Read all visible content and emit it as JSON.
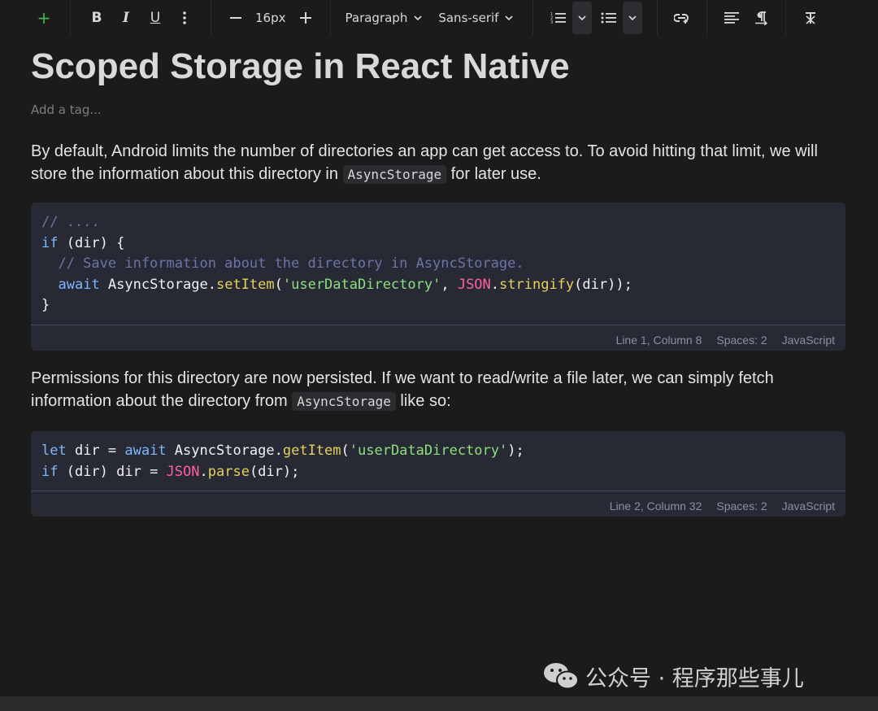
{
  "toolbar": {
    "font_size": "16px",
    "block_type": "Paragraph",
    "font_family": "Sans-serif"
  },
  "document": {
    "title": "Scoped Storage in React Native",
    "tag_placeholder": "Add a tag...",
    "para1": {
      "before": "By default, Android limits the number of directories an app can get access to. To avoid hitting that limit, we will store the information about this directory in ",
      "code": "AsyncStorage",
      "after": " for later use."
    },
    "code1": {
      "line1": "// ....",
      "line2_kw": "if",
      "line2_rest": " (dir) {",
      "line3": "  // Save information about the directory in AsyncStorage.",
      "line4_kw": "await",
      "line4_obj": " AsyncStorage.",
      "line4_fn": "setItem",
      "line4_p1": "(",
      "line4_str": "'userDataDirectory'",
      "line4_p2": ", ",
      "line4_json": "JSON",
      "line4_dot": ".",
      "line4_fn2": "stringify",
      "line4_end": "(dir));",
      "line5": "}",
      "status": {
        "position": "Line 1, Column 8",
        "spaces": "Spaces: 2",
        "language": "JavaScript"
      }
    },
    "para2": {
      "before": "Permissions for this directory are now persisted. If we want to read/write a file later, we can simply fetch information about the directory from ",
      "code": "AsyncStorage",
      "after": " like so:"
    },
    "code2": {
      "l1_kw": "let",
      "l1_a": " dir = ",
      "l1_kw2": "await",
      "l1_b": " AsyncStorage.",
      "l1_fn": "getItem",
      "l1_p": "(",
      "l1_str": "'userDataDirectory'",
      "l1_end": ");",
      "l2_kw": "if",
      "l2_a": " (dir) dir = ",
      "l2_json": "JSON",
      "l2_dot": ".",
      "l2_fn": "parse",
      "l2_end": "(dir);",
      "status": {
        "position": "Line 2, Column 32",
        "spaces": "Spaces: 2",
        "language": "JavaScript"
      }
    }
  },
  "watermark": {
    "text": "公众号 · 程序那些事儿",
    "icon": "wechat-icon"
  },
  "colors": {
    "accent_plus": "#3fb950",
    "code_bg": "#272935",
    "keyword": "#7fb7ff",
    "function": "#e6d15b",
    "string": "#8ee07c",
    "json": "#ff5fa2",
    "comment": "#6b74a6"
  }
}
